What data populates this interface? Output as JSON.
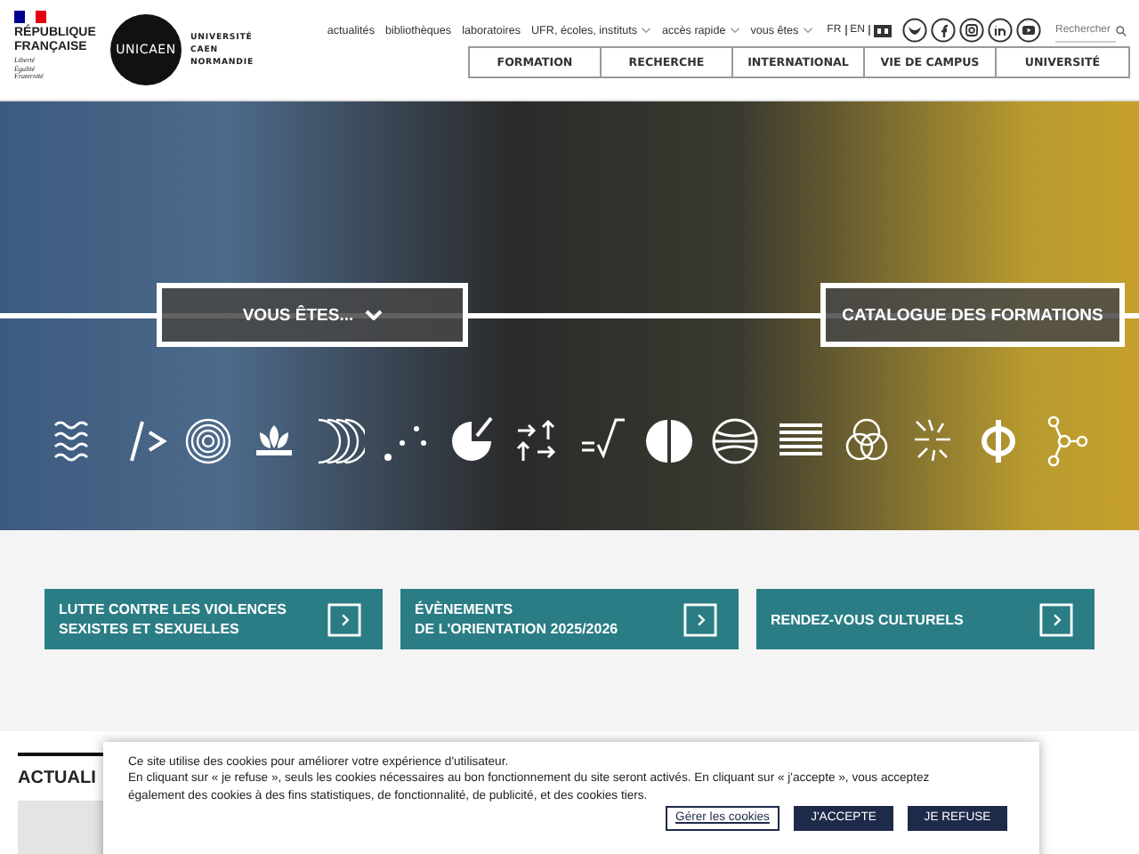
{
  "header": {
    "republic": {
      "name_lines": [
        "RÉPUBLIQUE",
        "FRANÇAISE"
      ],
      "motto_lines": [
        "Liberté",
        "Égalité",
        "Fraternité"
      ]
    },
    "university": {
      "mark": "UNICAEN",
      "name_lines": [
        "UNIVERSITÉ",
        "CAEN",
        "NORMANDIE"
      ]
    },
    "top_links": [
      {
        "label": "actualités",
        "dropdown": false
      },
      {
        "label": "bibliothèques",
        "dropdown": false
      },
      {
        "label": "laboratoires",
        "dropdown": false
      },
      {
        "label": "UFR, écoles, instituts",
        "dropdown": true
      },
      {
        "label": "accès rapide",
        "dropdown": true
      },
      {
        "label": "vous êtes",
        "dropdown": true
      }
    ],
    "languages": [
      "FR",
      "EN"
    ],
    "search": {
      "placeholder": "Rechercher"
    },
    "nav": [
      "FORMATION",
      "RECHERCHE",
      "INTERNATIONAL",
      "VIE DE CAMPUS",
      "UNIVERSITÉ"
    ]
  },
  "hero": {
    "buttons": [
      {
        "label": "VOUS ÊTES...",
        "kind": "dropdown"
      },
      {
        "label": "CATALOGUE DES FORMATIONS",
        "kind": "link"
      }
    ]
  },
  "tiles": [
    {
      "lines": [
        "LUTTE CONTRE LES VIOLENCES",
        "SEXISTES ET SEXUELLES"
      ]
    },
    {
      "lines": [
        "ÉVÈNEMENTS",
        "DE L'ORIENTATION 2025/2026"
      ]
    },
    {
      "lines": [
        "RENDEZ-VOUS CULTURELS"
      ]
    }
  ],
  "news": {
    "heading": "ACTUALI"
  },
  "cookie_banner": {
    "paragraphs": [
      "Ce site utilise des cookies pour améliorer votre expérience d'utilisateur.",
      "En cliquant sur « je refuse », seuls les cookies nécessaires au bon fonctionnement du site seront activés. En cliquant sur « j'accepte », vous acceptez également des cookies à des fins statistiques, de fonctionnalité, de publicité, et des cookies tiers."
    ],
    "buttons": [
      {
        "label": "Gérer les cookies",
        "kind": "manage"
      },
      {
        "label": "J'ACCEPTE",
        "kind": "accept"
      },
      {
        "label": "JE REFUSE",
        "kind": "refuse"
      }
    ]
  }
}
